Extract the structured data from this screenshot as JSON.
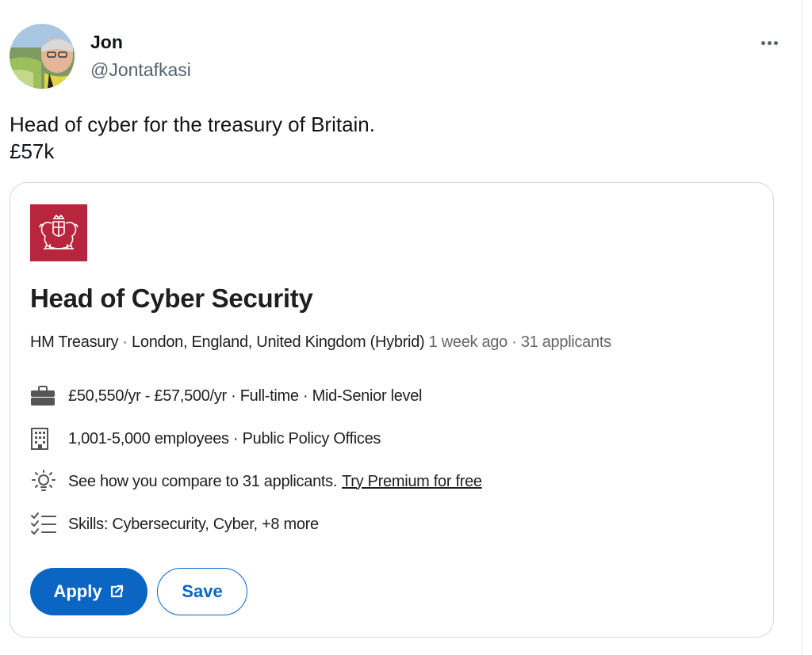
{
  "tweet": {
    "author": {
      "display_name": "Jon",
      "handle": "@Jontafkasi"
    },
    "text_lines": [
      "Head of cyber for the treasury of Britain.",
      "£57k"
    ]
  },
  "job_card": {
    "title": "Head of Cyber Security",
    "company": "HM Treasury",
    "location": "London, England, United Kingdom (Hybrid)",
    "posted": "1 week ago",
    "applicants": "31 applicants",
    "details": {
      "salary": "£50,550/yr - £57,500/yr · Full-time · Mid-Senior level",
      "company_size": "1,001-5,000 employees · Public Policy Offices",
      "compare": "See how you compare to 31 applicants.",
      "premium_link": "Try Premium for free",
      "skills": "Skills: Cybersecurity, Cyber, +8 more"
    },
    "buttons": {
      "apply": "Apply",
      "save": "Save"
    }
  },
  "colors": {
    "logo_background": "#b7263c",
    "primary_blue": "#0a66c2",
    "card_border": "#cfd9de",
    "handle_gray": "#536471"
  },
  "icons": {
    "more": "more-horizontal-icon",
    "salary": "briefcase-icon",
    "company": "building-icon",
    "compare": "lightbulb-icon",
    "skills": "checklist-icon",
    "apply": "external-link-icon"
  }
}
